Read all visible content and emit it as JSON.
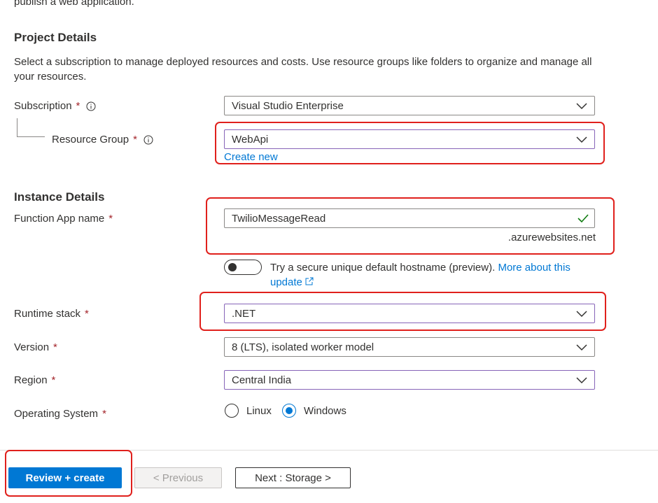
{
  "header": {
    "clipped_text": "publish a web application."
  },
  "project_details": {
    "title": "Project Details",
    "description": "Select a subscription to manage deployed resources and costs. Use resource groups like folders to organize and manage all your resources.",
    "subscription": {
      "label": "Subscription",
      "required": "*",
      "value": "Visual Studio Enterprise"
    },
    "resource_group": {
      "label": "Resource Group",
      "required": "*",
      "value": "WebApi",
      "create_new": "Create new"
    }
  },
  "instance_details": {
    "title": "Instance Details",
    "function_app_name": {
      "label": "Function App name",
      "required": "*",
      "value": "TwilioMessageRead",
      "suffix": ".azurewebsites.net"
    },
    "hostname_toggle": {
      "text": "Try a secure unique default hostname (preview).",
      "link_part1": "More about this",
      "link_part2": "update",
      "state": "off"
    },
    "runtime_stack": {
      "label": "Runtime stack",
      "required": "*",
      "value": ".NET"
    },
    "version": {
      "label": "Version",
      "required": "*",
      "value": "8 (LTS), isolated worker model"
    },
    "region": {
      "label": "Region",
      "required": "*",
      "value": "Central India"
    },
    "operating_system": {
      "label": "Operating System",
      "required": "*",
      "options": [
        "Linux",
        "Windows"
      ],
      "selected": "Windows"
    }
  },
  "footer": {
    "review_create": "Review + create",
    "previous": "< Previous",
    "next": "Next : Storage >"
  },
  "colors": {
    "accent": "#0078d4",
    "highlight_box": "#e0201c",
    "required": "#a4262c",
    "valid_check": "#107c10",
    "focus_border": "#8764b8"
  },
  "icons": [
    "info-icon",
    "chevron-down-icon",
    "checkmark-icon",
    "external-link-icon"
  ]
}
